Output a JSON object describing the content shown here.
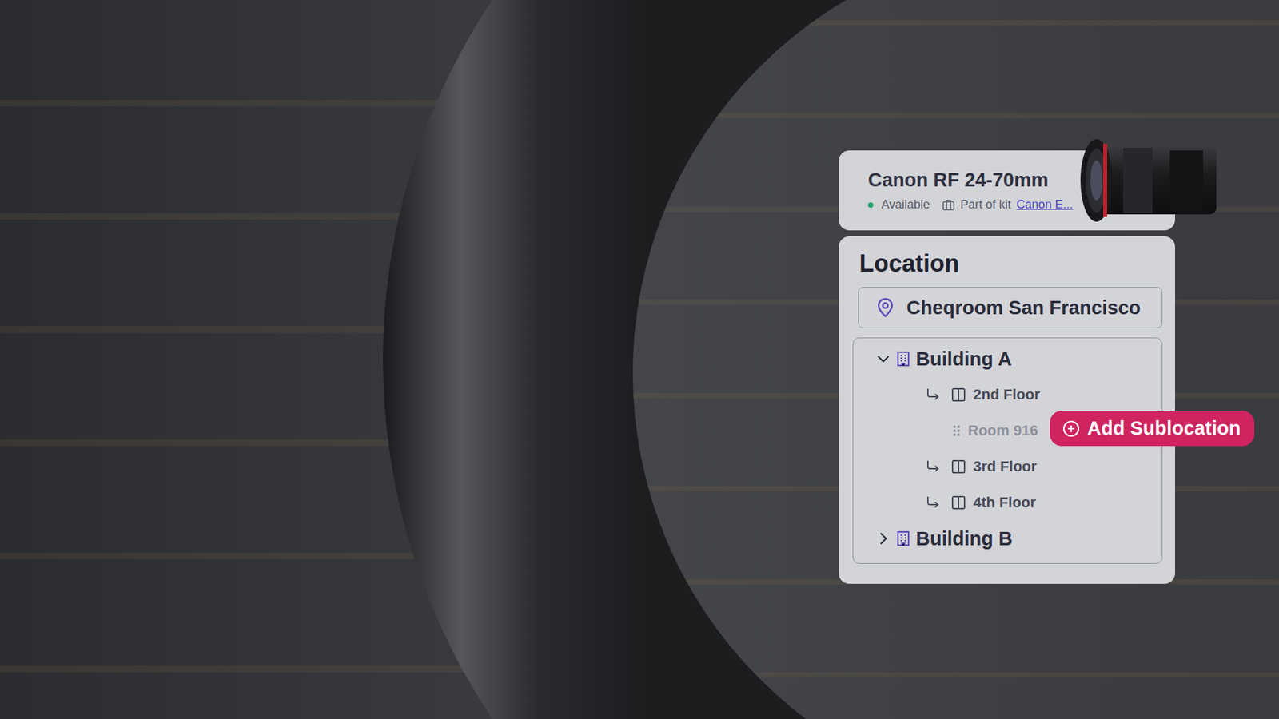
{
  "item": {
    "title": "Canon RF 24-70mm",
    "status": "Available",
    "kit_label": "Part of kit",
    "kit_link": "Canon E..."
  },
  "location": {
    "title": "Location",
    "value": "Cheqroom San Francisco"
  },
  "tree": [
    {
      "label": "Building A",
      "kind": "building",
      "expanded": true,
      "dimmed": false
    },
    {
      "label": "2nd Floor",
      "kind": "floor",
      "dimmed": false
    },
    {
      "label": "Room 916",
      "kind": "room",
      "dimmed": true
    },
    {
      "label": "3rd Floor",
      "kind": "floor",
      "dimmed": false
    },
    {
      "label": "4th Floor",
      "kind": "floor",
      "dimmed": false
    },
    {
      "label": "Building B",
      "kind": "building",
      "expanded": false,
      "dimmed": false
    }
  ],
  "action": {
    "label": "Add Sublocation"
  }
}
